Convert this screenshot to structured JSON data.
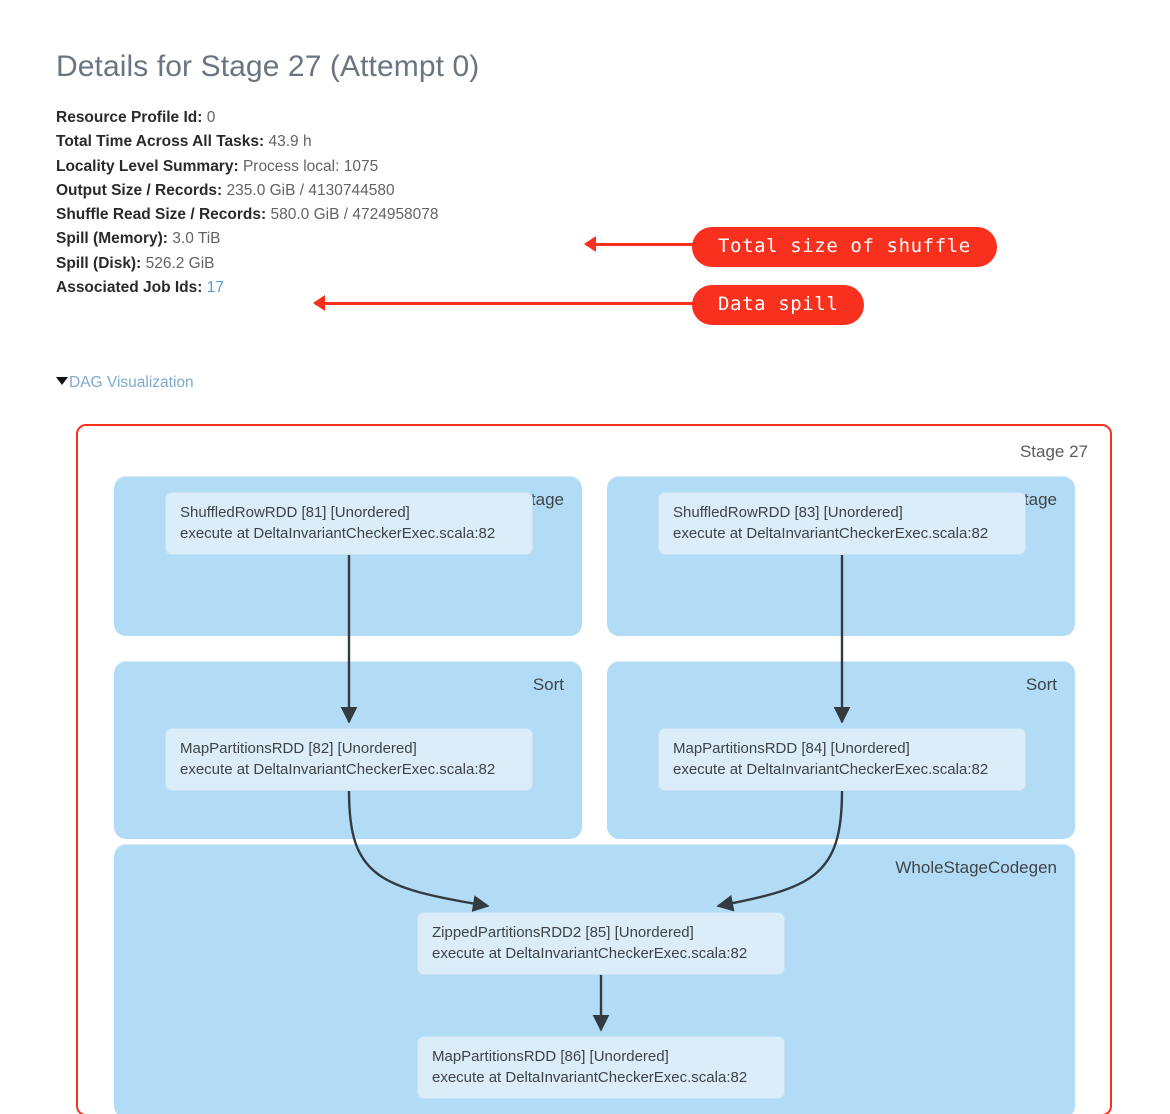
{
  "header": {
    "title": "Details for Stage 27 (Attempt 0)",
    "rows": [
      {
        "key": "Resource Profile Id:",
        "value": "0",
        "link": false
      },
      {
        "key": "Total Time Across All Tasks:",
        "value": "43.9 h",
        "link": false
      },
      {
        "key": "Locality Level Summary:",
        "value": "Process local: 1075",
        "link": false
      },
      {
        "key": "Output Size / Records:",
        "value": "235.0 GiB / 4130744580",
        "link": false
      },
      {
        "key": "Shuffle Read Size / Records:",
        "value": "580.0 GiB / 4724958078",
        "link": false
      },
      {
        "key": "Spill (Memory):",
        "value": "3.0 TiB",
        "link": false
      },
      {
        "key": "Spill (Disk):",
        "value": "526.2 GiB",
        "link": false
      },
      {
        "key": "Associated Job Ids:",
        "value": "17",
        "link": true
      }
    ]
  },
  "dag_toggle": {
    "label": "DAG Visualization",
    "caret_icon": "caret-down-icon"
  },
  "annotations": [
    {
      "id": "shuffle",
      "label": "Total size of shuffle",
      "color": "#f9301d",
      "targets": "Shuffle Read Size / Records"
    },
    {
      "id": "spill",
      "label": "Data spill",
      "color": "#f9301d",
      "targets": "Spill (Disk)"
    }
  ],
  "dag": {
    "stage_label": "Stage 27",
    "border_color": "#f9301d",
    "scope_fill": "#b2dcf6",
    "node_fill": "#dcedfa",
    "scopes": [
      {
        "id": "sqs-left",
        "label": "ShuffleQueryStage"
      },
      {
        "id": "sqs-right",
        "label": "ShuffleQueryStage"
      },
      {
        "id": "sort-left",
        "label": "Sort"
      },
      {
        "id": "sort-right",
        "label": "Sort"
      },
      {
        "id": "wsc",
        "label": "WholeStageCodegen"
      }
    ],
    "nodes": [
      {
        "id": "rdd-81",
        "line1": "ShuffledRowRDD [81] [Unordered]",
        "line2": "execute at DeltaInvariantCheckerExec.scala:82"
      },
      {
        "id": "rdd-83",
        "line1": "ShuffledRowRDD [83] [Unordered]",
        "line2": "execute at DeltaInvariantCheckerExec.scala:82"
      },
      {
        "id": "rdd-82",
        "line1": "MapPartitionsRDD [82] [Unordered]",
        "line2": "execute at DeltaInvariantCheckerExec.scala:82"
      },
      {
        "id": "rdd-84",
        "line1": "MapPartitionsRDD [84] [Unordered]",
        "line2": "execute at DeltaInvariantCheckerExec.scala:82"
      },
      {
        "id": "rdd-85",
        "line1": "ZippedPartitionsRDD2 [85] [Unordered]",
        "line2": "execute at DeltaInvariantCheckerExec.scala:82"
      },
      {
        "id": "rdd-86",
        "line1": "MapPartitionsRDD [86] [Unordered]",
        "line2": "execute at DeltaInvariantCheckerExec.scala:82"
      }
    ],
    "edges": [
      {
        "from": "rdd-81",
        "to": "rdd-82"
      },
      {
        "from": "rdd-83",
        "to": "rdd-84"
      },
      {
        "from": "rdd-82",
        "to": "rdd-85"
      },
      {
        "from": "rdd-84",
        "to": "rdd-85"
      },
      {
        "from": "rdd-85",
        "to": "rdd-86"
      }
    ]
  }
}
